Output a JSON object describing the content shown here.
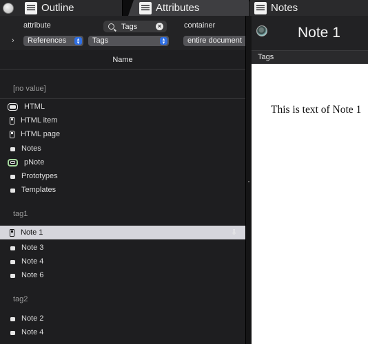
{
  "tabs": [
    {
      "label": "Outline"
    },
    {
      "label": "Attributes"
    },
    {
      "label": "Notes"
    }
  ],
  "query": {
    "attribute_label": "attribute",
    "container_label": "container",
    "search_value": "Tags",
    "attribute_popup": "References",
    "value_popup": "Tags",
    "container_popup": "entire document"
  },
  "column_header": "Name",
  "groups": {
    "no_value": {
      "label": "[no value]",
      "items": [
        {
          "label": "HTML",
          "icon": "prototype-icon"
        },
        {
          "label": "HTML item",
          "icon": "tall-note-icon"
        },
        {
          "label": "HTML page",
          "icon": "tall-note-icon"
        },
        {
          "label": "Notes",
          "icon": "note-icon"
        },
        {
          "label": "pNote",
          "icon": "prototype-note-icon"
        },
        {
          "label": "Prototypes",
          "icon": "note-icon"
        },
        {
          "label": "Templates",
          "icon": "note-icon"
        }
      ]
    },
    "tag1": {
      "label": "tag1",
      "items": [
        {
          "label": "Note 1",
          "icon": "tall-note-icon",
          "selected": true
        },
        {
          "label": "Note 3",
          "icon": "note-icon"
        },
        {
          "label": "Note 4",
          "icon": "note-icon"
        },
        {
          "label": "Note 6",
          "icon": "note-icon"
        }
      ]
    },
    "tag2": {
      "label": "tag2",
      "items": [
        {
          "label": "Note 2",
          "icon": "note-icon"
        },
        {
          "label": "Note 4",
          "icon": "note-icon"
        }
      ]
    }
  },
  "note": {
    "title": "Note 1",
    "tags_label": "Tags",
    "text": "This is text of Note 1"
  }
}
